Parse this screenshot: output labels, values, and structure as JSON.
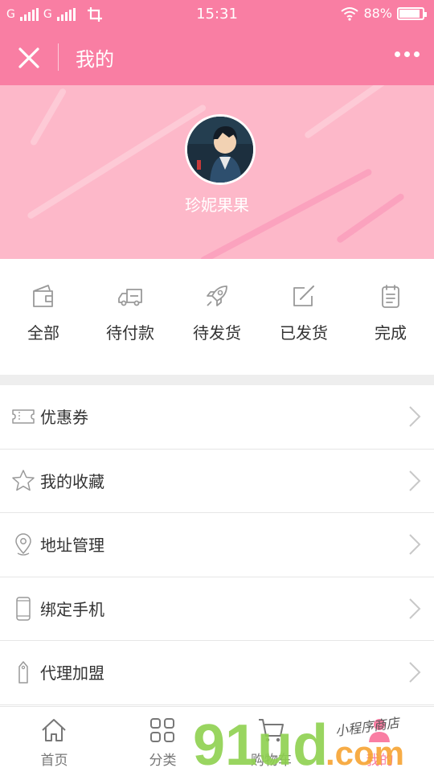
{
  "status_bar": {
    "carrier1": "G",
    "carrier2": "G",
    "time": "15:31",
    "battery": "88%",
    "battery_level": 0.88
  },
  "header": {
    "title": "我的"
  },
  "profile": {
    "username": "珍妮果果"
  },
  "orders": [
    {
      "label": "全部",
      "icon": "wallet-icon"
    },
    {
      "label": "待付款",
      "icon": "truck-icon"
    },
    {
      "label": "待发货",
      "icon": "rocket-icon"
    },
    {
      "label": "已发货",
      "icon": "edit-icon"
    },
    {
      "label": "完成",
      "icon": "clipboard-icon"
    }
  ],
  "menu": [
    {
      "label": "优惠券",
      "icon": "ticket-icon"
    },
    {
      "label": "我的收藏",
      "icon": "star-icon"
    },
    {
      "label": "地址管理",
      "icon": "location-icon"
    },
    {
      "label": "绑定手机",
      "icon": "phone-icon"
    },
    {
      "label": "代理加盟",
      "icon": "tag-icon"
    }
  ],
  "tabs": [
    {
      "label": "首页",
      "icon": "home-icon"
    },
    {
      "label": "分类",
      "icon": "grid-icon"
    },
    {
      "label": "购物车",
      "icon": "cart-icon"
    },
    {
      "label": "我的",
      "icon": "user-icon"
    }
  ],
  "watermark": {
    "brand": "91ud",
    "suffix": ".com",
    "tagline": "小程序商店"
  },
  "colors": {
    "accent": "#f97ea3",
    "banner": "#fdb8c9",
    "icon_gray": "#999999",
    "watermark_green": "#8fd14f",
    "watermark_orange": "#f7a432"
  }
}
